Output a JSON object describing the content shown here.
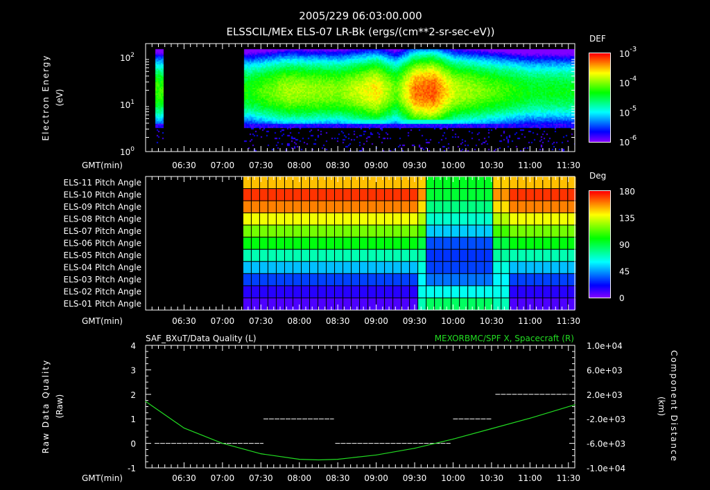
{
  "header": {
    "datetime": "2005/229 06:03:00.000",
    "title": "ELSSCIL/MEx ELS-07 LR-Bk  (ergs/(cm**2-sr-sec-eV))"
  },
  "time_axis": {
    "label": "GMT(min)",
    "ticks": [
      "06:30",
      "07:00",
      "07:30",
      "08:00",
      "08:30",
      "09:00",
      "09:30",
      "10:00",
      "10:30",
      "11:00",
      "11:30"
    ],
    "range_min": [
      360,
      695
    ]
  },
  "colors": {
    "background": "#000000",
    "text": "#ffffff",
    "curve": "#22dd22"
  },
  "chart_data": [
    {
      "type": "heatmap",
      "name": "energy-spectrogram",
      "ylabel": "Electron Energy",
      "yunits": "(eV)",
      "yscale": "log",
      "ylim": [
        1,
        150
      ],
      "yticks": [
        {
          "base": "10",
          "exp": "0",
          "value": 1
        },
        {
          "base": "10",
          "exp": "1",
          "value": 10
        },
        {
          "base": "10",
          "exp": "2",
          "value": 100
        }
      ],
      "colorbar": {
        "title": "DEF",
        "scale": "log",
        "range": [
          1e-06,
          0.001
        ],
        "ticks": [
          {
            "base": "10",
            "exp": "-3",
            "value": -3
          },
          {
            "base": "10",
            "exp": "-4",
            "value": -4
          },
          {
            "base": "10",
            "exp": "-5",
            "value": -5
          },
          {
            "base": "10",
            "exp": "-6",
            "value": -6
          }
        ]
      },
      "data_intervals_min": [
        [
          367,
          374
        ],
        [
          436,
          695
        ]
      ],
      "low_energy_cutoff_eV": 4,
      "profile": [
        {
          "t": 367,
          "logdef": -4.2
        },
        {
          "t": 440,
          "logdef": -4.3
        },
        {
          "t": 470,
          "logdef": -3.9
        },
        {
          "t": 510,
          "logdef": -4.0
        },
        {
          "t": 540,
          "logdef": -3.6
        },
        {
          "t": 555,
          "logdef": -4.1
        },
        {
          "t": 570,
          "logdef": -3.3
        },
        {
          "t": 585,
          "logdef": -3.2
        },
        {
          "t": 600,
          "logdef": -3.8
        },
        {
          "t": 630,
          "logdef": -4.1
        },
        {
          "t": 660,
          "logdef": -4.4
        },
        {
          "t": 695,
          "logdef": -4.4
        }
      ]
    },
    {
      "type": "heatmap",
      "name": "pitch-angle",
      "colorbar": {
        "title": "Deg",
        "range": [
          0,
          180
        ],
        "ticks": [
          "180",
          "135",
          "90",
          "45",
          "0"
        ]
      },
      "data_interval_min": [
        436,
        690
      ],
      "rows": [
        {
          "label": "ELS-11 Pitch Angle",
          "outer": 150,
          "inner": 95
        },
        {
          "label": "ELS-10 Pitch Angle",
          "outer": 172,
          "inner": 92
        },
        {
          "label": "ELS-09 Pitch Angle",
          "outer": 160,
          "inner": 80
        },
        {
          "label": "ELS-08 Pitch Angle",
          "outer": 138,
          "inner": 68
        },
        {
          "label": "ELS-07 Pitch Angle",
          "outer": 118,
          "inner": 52
        },
        {
          "label": "ELS-06 Pitch Angle",
          "outer": 98,
          "inner": 32
        },
        {
          "label": "ELS-05 Pitch Angle",
          "outer": 72,
          "inner": 28
        },
        {
          "label": "ELS-04 Pitch Angle",
          "outer": 50,
          "inner": 30
        },
        {
          "label": "ELS-03 Pitch Angle",
          "outer": 30,
          "inner": 38
        },
        {
          "label": "ELS-02 Pitch Angle",
          "outer": 14,
          "inner": 62
        },
        {
          "label": "ELS-01 Pitch Angle",
          "outer": 8,
          "inner": 85
        }
      ],
      "inner_interval_min": [
        574,
        634
      ]
    },
    {
      "type": "line",
      "name": "data-quality-and-position",
      "left_title": "SAF_BXuT/Data Quality (L)",
      "right_title": "MEXORBMC/SPF X, Spacecraft (R)",
      "ylabel_left": "Raw Data Quality",
      "ylabel_left_units": "(Raw)",
      "ylabel_right": "Component Distance",
      "ylabel_right_units": "(km)",
      "ylim_left": [
        -1,
        4
      ],
      "yticks_left": [
        "4",
        "3",
        "2",
        "1",
        "0",
        "-1"
      ],
      "ylim_right": [
        -10000,
        10000
      ],
      "yticks_right": [
        "1.0e+04",
        "6.0e+03",
        "2.0e+03",
        "-2.0e+03",
        "-6.0e+03",
        "-1.0e+04"
      ],
      "quality_segments": [
        {
          "start": 367,
          "end": 452,
          "value": 0
        },
        {
          "start": 452,
          "end": 507,
          "value": 1
        },
        {
          "start": 508,
          "end": 598,
          "value": 0
        },
        {
          "start": 600,
          "end": 630,
          "value": 1
        },
        {
          "start": 633,
          "end": 690,
          "value": 2
        }
      ],
      "position_km": {
        "x": [
          360,
          390,
          420,
          450,
          480,
          495,
          510,
          540,
          570,
          600,
          630,
          660,
          695
        ],
        "y": [
          850,
          -3500,
          -6000,
          -7700,
          -8600,
          -8700,
          -8600,
          -7900,
          -6800,
          -5300,
          -3600,
          -1900,
          300
        ]
      }
    }
  ]
}
